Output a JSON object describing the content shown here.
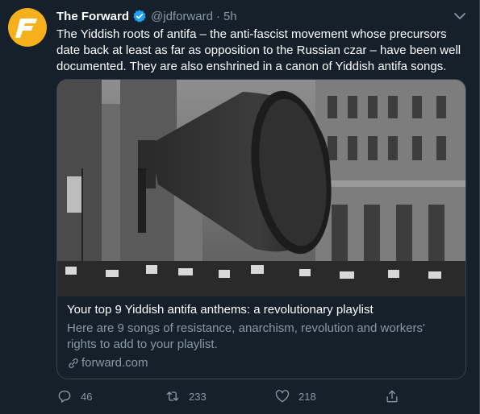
{
  "tweet": {
    "author_name": "The Forward",
    "author_handle": "@jdforward",
    "separator": "·",
    "time": "5h",
    "text": "The Yiddish roots of antifa – the anti-fascist movement whose precursors date back at least as far as opposition to the Russian czar – have been well documented. They are also enshrined in a canon of Yiddish antifa songs."
  },
  "card": {
    "title": "Your top 9 Yiddish antifa anthems: a revolutionary playlist",
    "description": "Here are 9 songs of resistance, anarchism, revolution and workers' rights to add to your playlist.",
    "domain": "forward.com"
  },
  "actions": {
    "replies": "46",
    "retweets": "233",
    "likes": "218"
  },
  "colors": {
    "background": "#15202b",
    "secondary_text": "#8899a6",
    "border": "#38444d",
    "verified": "#1da1f2",
    "avatar": "#f5b01c"
  }
}
